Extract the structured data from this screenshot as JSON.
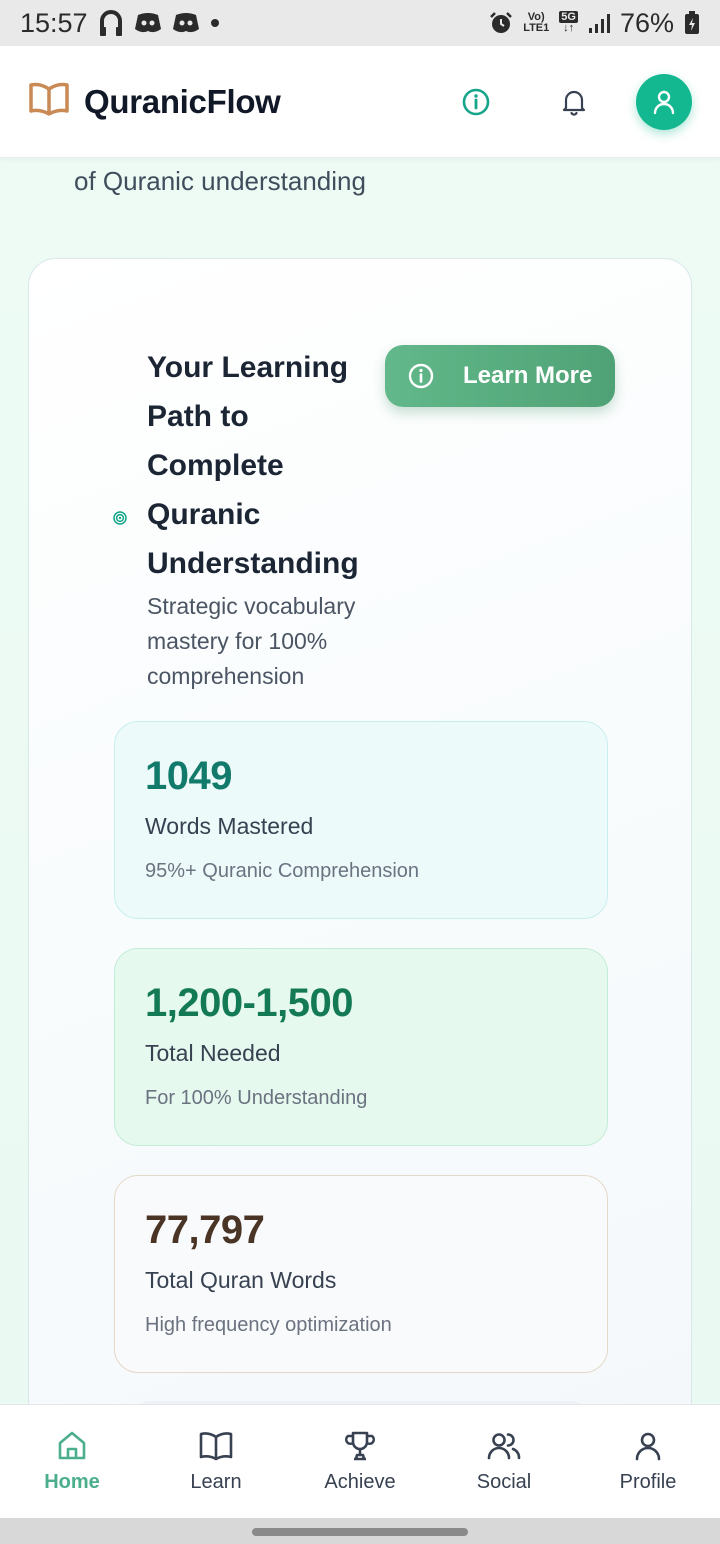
{
  "status_bar": {
    "time": "15:57",
    "volte": "Vo)",
    "lte": "LTE1",
    "network": "5G",
    "battery": "76%"
  },
  "header": {
    "brand": "QuranicFlow",
    "brand_color": "#c98a55",
    "accent": "#14b890"
  },
  "intro": {
    "tail_text": "of Quranic understanding"
  },
  "path_card": {
    "title": "Your Learning Path to Complete Quranic Understanding",
    "subtitle": "Strategic vocabulary mastery for 100% comprehension",
    "learn_more_label": "Learn More"
  },
  "stats": [
    {
      "value": "1049",
      "label": "Words Mastered",
      "note": "95%+ Quranic Comprehension"
    },
    {
      "value": "1,200-1,500",
      "label": "Total Needed",
      "note": "For 100% Understanding"
    },
    {
      "value": "77,797",
      "label": "Total Quran Words",
      "note": "High frequency optimization"
    }
  ],
  "nav": {
    "items": [
      {
        "label": "Home",
        "icon": "home-icon",
        "active": true
      },
      {
        "label": "Learn",
        "icon": "book-icon",
        "active": false
      },
      {
        "label": "Achieve",
        "icon": "trophy-icon",
        "active": false
      },
      {
        "label": "Social",
        "icon": "users-icon",
        "active": false
      },
      {
        "label": "Profile",
        "icon": "user-icon",
        "active": false
      }
    ],
    "active_color": "#4caf8c"
  }
}
